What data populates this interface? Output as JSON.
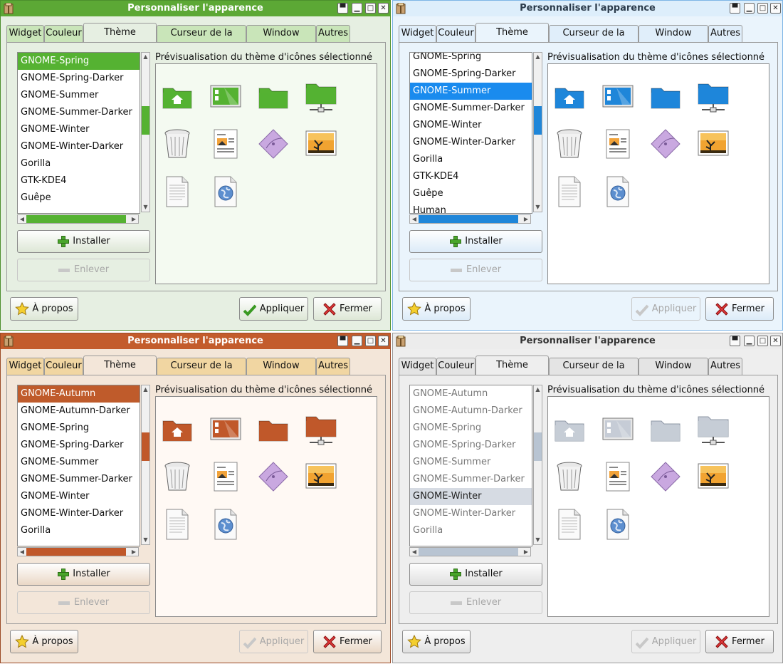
{
  "windows": [
    {
      "theme": "green",
      "colors": {
        "accent": "#55b232",
        "titlebar": "#5ca835",
        "selection": "#55b232",
        "background": "#e6efe2",
        "tab": "#c9e5b9",
        "preview": "#f4faf1",
        "button": "#dde7d6"
      },
      "title": "Personnaliser l'apparence",
      "tabs": [
        "Widget",
        "Couleur",
        "Thème d'icônes",
        "Curseur de la souris",
        "Window Border",
        "Autres"
      ],
      "preview_label": "Prévisualisation du thème d'icônes sélectionné",
      "list_items": [
        "GNOME-Spring",
        "GNOME-Spring-Darker",
        "GNOME-Summer",
        "GNOME-Summer-Darker",
        "GNOME-Winter",
        "GNOME-Winter-Darker",
        "Gorilla",
        "GTK-KDE4",
        "Guêpe"
      ],
      "selected": "GNOME-Spring",
      "install_label": "Installer",
      "remove_label": "Enlever",
      "about_label": "À propos",
      "apply_label": "Appliquer",
      "close_label": "Fermer",
      "apply_enabled": true
    },
    {
      "theme": "blue",
      "colors": {
        "accent": "#1f86d9",
        "titlebar": "#ddeefb",
        "selection": "#1a8bee",
        "background": "#eaf4fc",
        "tab": "#e0eefa",
        "preview": "#ffffff",
        "button": "#dcebf8"
      },
      "title": "Personnaliser l'apparence",
      "tabs": [
        "Widget",
        "Couleur",
        "Thème d'icônes",
        "Curseur de la souris",
        "Window Border",
        "Autres"
      ],
      "preview_label": "Prévisualisation du thème d'icônes sélectionné",
      "list_items": [
        "GNOME-Spring",
        "GNOME-Spring-Darker",
        "GNOME-Summer",
        "GNOME-Summer-Darker",
        "GNOME-Winter",
        "GNOME-Winter-Darker",
        "Gorilla",
        "GTK-KDE4",
        "Guêpe",
        "Human"
      ],
      "selected": "GNOME-Summer",
      "install_label": "Installer",
      "remove_label": "Enlever",
      "about_label": "À propos",
      "apply_label": "Appliquer",
      "close_label": "Fermer",
      "apply_enabled": false
    },
    {
      "theme": "orange",
      "colors": {
        "accent": "#c0582a",
        "titlebar": "#c35c2c",
        "selection": "#bf5b2b",
        "background": "#f3e6d9",
        "tab": "#f1d6a2",
        "preview": "#fff9f4",
        "button": "#ead8c6"
      },
      "title": "Personnaliser l'apparence",
      "tabs": [
        "Widget",
        "Couleur",
        "Thème d'icônes",
        "Curseur de la souris",
        "Window Border",
        "Autres"
      ],
      "preview_label": "Prévisualisation du thème d'icônes sélectionné",
      "list_items": [
        "GNOME-Autumn",
        "GNOME-Autumn-Darker",
        "GNOME-Spring",
        "GNOME-Spring-Darker",
        "GNOME-Summer",
        "GNOME-Summer-Darker",
        "GNOME-Winter",
        "GNOME-Winter-Darker",
        "Gorilla"
      ],
      "selected": "GNOME-Autumn",
      "install_label": "Installer",
      "remove_label": "Enlever",
      "about_label": "À propos",
      "apply_label": "Appliquer",
      "close_label": "Fermer",
      "apply_enabled": false
    },
    {
      "theme": "gray",
      "colors": {
        "accent": "#b8c4d2",
        "titlebar": "#ececec",
        "selection": "#d6dbe3",
        "background": "#eeeeee",
        "tab": "#e4e4e4",
        "preview": "#ffffff",
        "button": "#e0e0e0"
      },
      "title": "Personnaliser l'apparence",
      "tabs": [
        "Widget",
        "Couleur",
        "Thème d'icônes",
        "Curseur de la souris",
        "Window Border",
        "Autres"
      ],
      "preview_label": "Prévisualisation du thème d'icônes sélectionné",
      "list_items": [
        "GNOME-Autumn",
        "GNOME-Autumn-Darker",
        "GNOME-Spring",
        "GNOME-Spring-Darker",
        "GNOME-Summer",
        "GNOME-Summer-Darker",
        "GNOME-Winter",
        "GNOME-Winter-Darker",
        "Gorilla"
      ],
      "selected": "GNOME-Winter",
      "install_label": "Installer",
      "remove_label": "Enlever",
      "about_label": "À propos",
      "apply_label": "Appliquer",
      "close_label": "Fermer",
      "apply_enabled": false
    }
  ],
  "icons": [
    "home-folder-icon",
    "desktop-icon",
    "folder-icon",
    "network-folder-icon",
    "trash-icon",
    "image-document-icon",
    "vector-graphic-icon",
    "picture-icon",
    "text-file-icon",
    "web-document-icon"
  ]
}
